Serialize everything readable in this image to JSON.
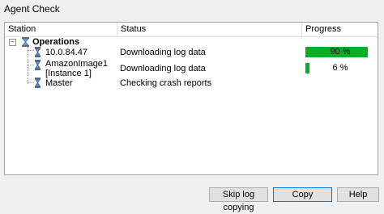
{
  "window": {
    "title": "Agent Check"
  },
  "columns": {
    "station": "Station",
    "status": "Status",
    "progress": "Progress"
  },
  "tree": {
    "group": {
      "name": "Operations"
    },
    "rows": [
      {
        "station": "10.0.84.47",
        "status": "Downloading log data",
        "progress": 0.9,
        "progress_label": "90 %"
      },
      {
        "station_line1": "AmazonImage1",
        "station_line2": "[Instance 1]",
        "status": "Downloading log data",
        "progress": 0.06,
        "progress_label": "6 %"
      },
      {
        "station": "Master",
        "status": "Checking crash reports"
      }
    ]
  },
  "buttons": {
    "skip": "Skip log copying",
    "copy": "Copy",
    "help": "Help"
  },
  "colors": {
    "progress_fill": "#06b025",
    "accent": "#0078d7"
  }
}
